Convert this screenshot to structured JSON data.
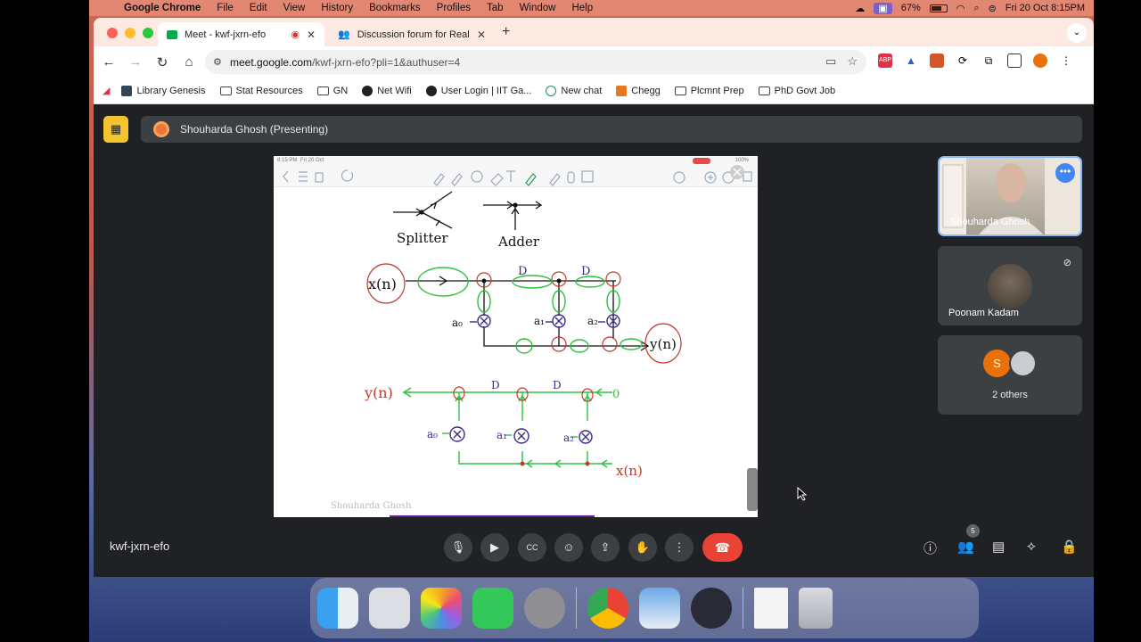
{
  "menubar": {
    "app": "Google Chrome",
    "items": [
      "File",
      "Edit",
      "View",
      "History",
      "Bookmarks",
      "Profiles",
      "Tab",
      "Window",
      "Help"
    ],
    "battery": "67%",
    "datetime": "Fri 20 Oct  8:15PM"
  },
  "tabs": [
    {
      "label": "Meet - kwf-jxrn-efo"
    },
    {
      "label": "Discussion forum for Real-Ti"
    }
  ],
  "address": {
    "domain": "meet.google.com",
    "path": "/kwf-jxrn-efo?pli=1&authuser=4"
  },
  "bookmarks": [
    "Library Genesis",
    "Stat Resources",
    "GN",
    "Net Wifi",
    "User Login | IIT Ga...",
    "New chat",
    "Chegg",
    "Plcmnt Prep",
    "PhD Govt Job"
  ],
  "presenting": {
    "label": "Shouharda Ghosh (Presenting)"
  },
  "slide": {
    "status_time": "8:15 PM",
    "status_date": "Fri 20 Oct",
    "status_battery": "100%",
    "labels": {
      "splitter": "Splitter",
      "adder": "Adder",
      "xn": "x(n)",
      "yn": "y(n)",
      "d": "D",
      "a0": "a₀",
      "a1": "a₁",
      "a2": "a₂",
      "zero": "0"
    },
    "watermark": "Shouharda Ghosh"
  },
  "participants": [
    {
      "name": "Shouharda Ghosh"
    },
    {
      "name": "Poonam Kadam"
    },
    {
      "name": "2 others",
      "initial": "S"
    }
  ],
  "controls": {
    "meeting_code": "kwf-jxrn-efo",
    "people_count": "5"
  }
}
